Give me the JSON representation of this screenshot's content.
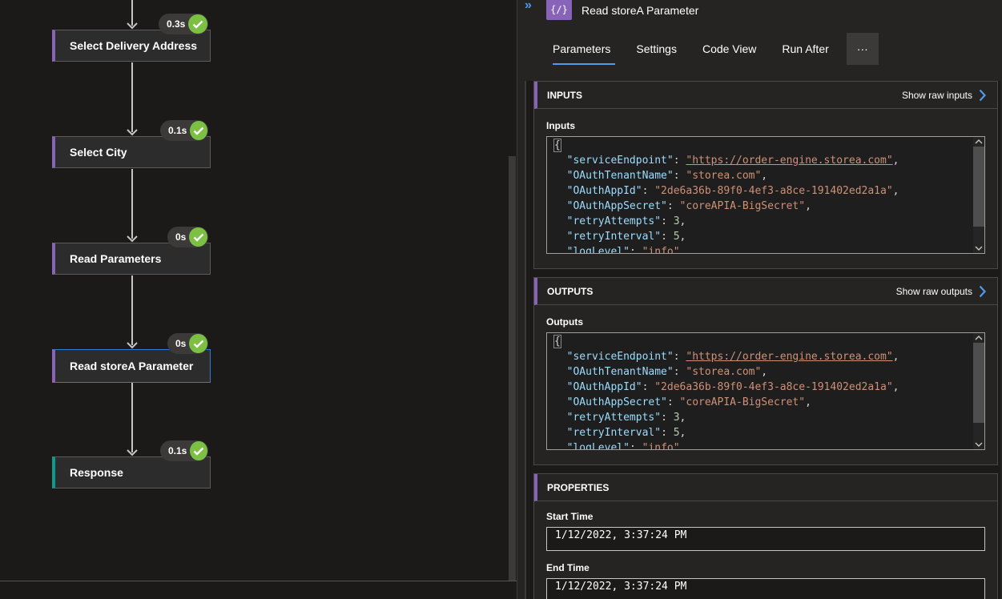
{
  "workflow": {
    "nodes": [
      {
        "label": "Select Delivery Address",
        "duration": "0.3s"
      },
      {
        "label": "Select City",
        "duration": "0.1s"
      },
      {
        "label": "Read Parameters",
        "duration": "0s"
      },
      {
        "label": "Read storeA Parameter",
        "duration": "0s"
      },
      {
        "label": "Response",
        "duration": "0.1s"
      }
    ]
  },
  "panel": {
    "title": "Read storeA Parameter",
    "icon_glyph": "{∕}",
    "collapse_glyph": "»",
    "tabs": [
      "Parameters",
      "Settings",
      "Code View",
      "Run After"
    ],
    "more_glyph": "···"
  },
  "inputs": {
    "header": "INPUTS",
    "raw_link": "Show raw inputs",
    "label": "Inputs"
  },
  "outputs": {
    "header": "OUTPUTS",
    "raw_link": "Show raw outputs",
    "label": "Outputs"
  },
  "json_content": {
    "open": "{",
    "serviceEndpoint_key": "\"serviceEndpoint\"",
    "serviceEndpoint_val": "\"https://order-engine.storea.com\"",
    "tenant_key": "\"OAuthTenantName\"",
    "tenant_val": "\"storea.com\"",
    "appid_key": "\"OAuthAppId\"",
    "appid_val": "\"2de6a36b-89f0-4ef3-a8ce-191402ed2a1a\"",
    "secret_key": "\"OAuthAppSecret\"",
    "secret_val": "\"coreAPIA-BigSecret\"",
    "retry_key": "\"retryAttempts\"",
    "retry_val": "3",
    "interval_key": "\"retryInterval\"",
    "interval_val": "5",
    "log_key": "\"logLevel\"",
    "log_val": "\"info\""
  },
  "properties": {
    "header": "PROPERTIES",
    "start_label": "Start Time",
    "start_value": "1/12/2022, 3:37:24 PM",
    "end_label": "End Time",
    "end_value": "1/12/2022, 3:37:24 PM"
  },
  "colors": {
    "accent_purple": "#8764b8",
    "accent_teal": "#0b9a8d",
    "success_green": "#7cc043",
    "link_blue": "#4f9bea",
    "selected_border": "#2d7cd6"
  }
}
